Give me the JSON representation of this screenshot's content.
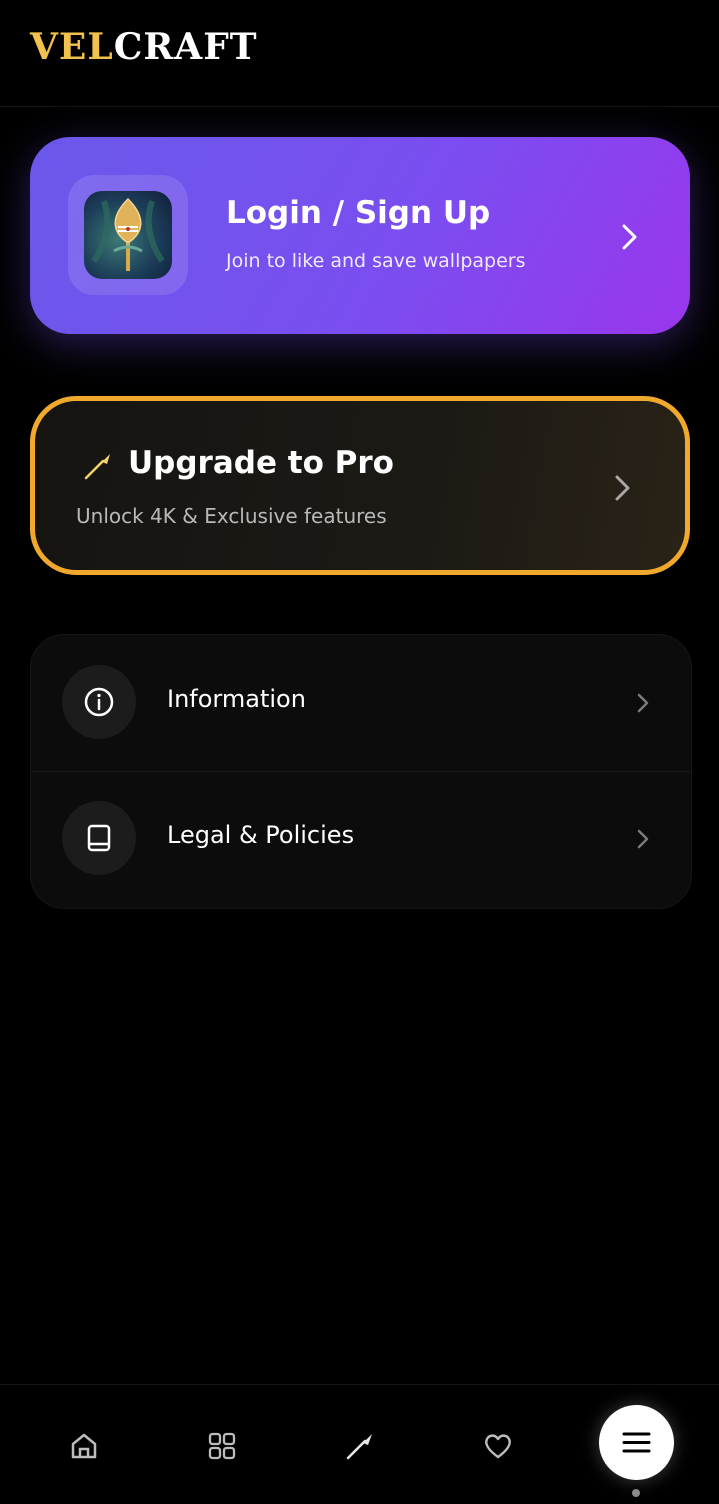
{
  "header": {
    "brand_part1": "VEL",
    "brand_part2": "CRAFT"
  },
  "login_card": {
    "title": "Login / Sign Up",
    "subtitle": "Join to like and save wallpapers",
    "icon": "app-logo-icon",
    "chevron": "chevron-right-icon"
  },
  "pro_card": {
    "title": "Upgrade to Pro",
    "subtitle": "Unlock 4K & Exclusive features",
    "icon": "spear-icon",
    "border_color": "#f0a92c"
  },
  "menu": {
    "items": [
      {
        "label": "Information",
        "icon": "info-icon"
      },
      {
        "label": "Legal & Policies",
        "icon": "book-icon"
      }
    ]
  },
  "bottom_nav": {
    "items": [
      {
        "icon": "home-icon"
      },
      {
        "icon": "grid-icon"
      },
      {
        "icon": "spear-icon"
      },
      {
        "icon": "heart-icon"
      },
      {
        "icon": "menu-icon",
        "active": true
      }
    ]
  },
  "colors": {
    "background": "#000000",
    "brand_gold": "#f2c14e",
    "login_gradient_start": "#6a59ea",
    "login_gradient_end": "#9a36ec"
  }
}
